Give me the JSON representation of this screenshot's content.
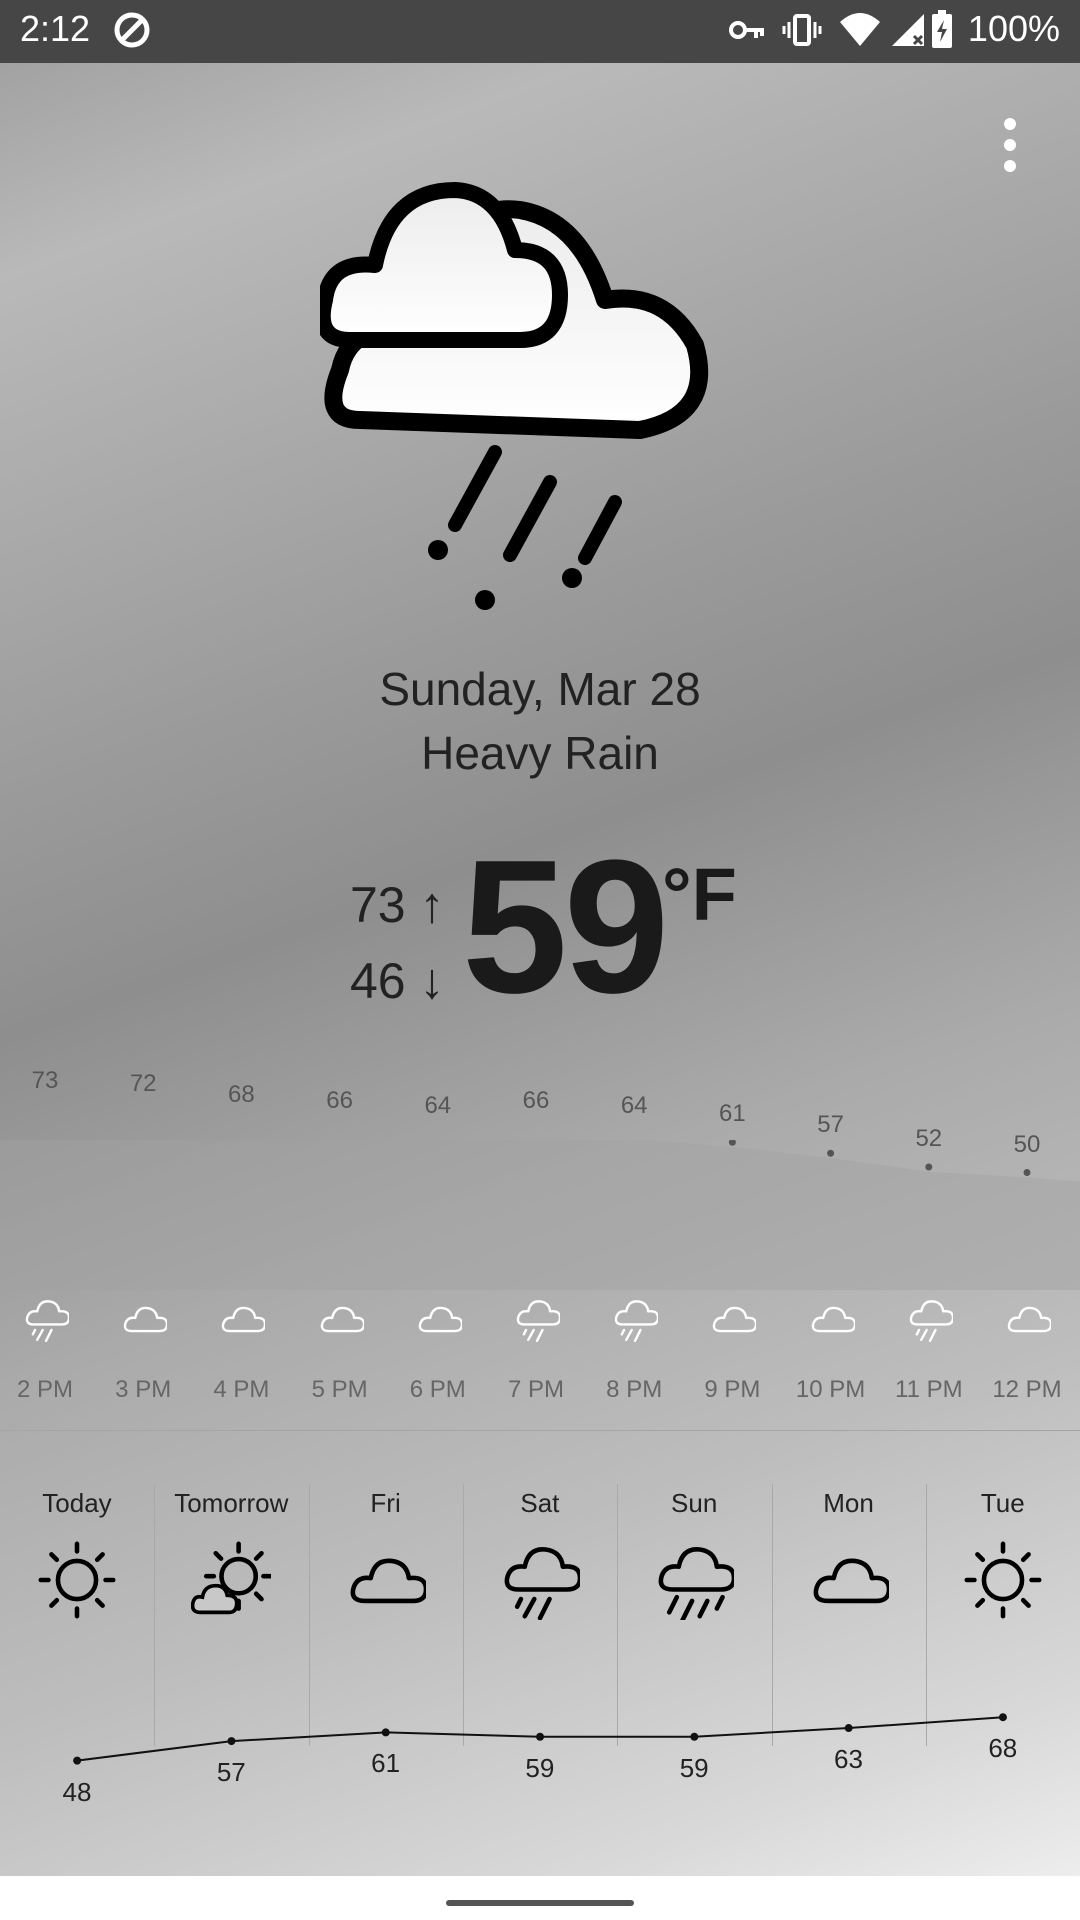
{
  "status_bar": {
    "time": "2:12",
    "battery_text": "100%",
    "icons": [
      "data-saver-icon",
      "vpn-key-icon",
      "vibrate-icon",
      "wifi-icon",
      "signal-icon",
      "battery-charging-icon"
    ]
  },
  "menu": {
    "icon": "more-vert-icon"
  },
  "current": {
    "icon": "heavy-rain-icon",
    "date": "Sunday, Mar 28",
    "condition": "Heavy Rain",
    "high": "73",
    "low": "46",
    "high_arrow": "↑",
    "low_arrow": "↓",
    "temp": "59",
    "unit": "°F"
  },
  "hourly": [
    {
      "time": "2 PM",
      "temp": 73,
      "icon": "rain-cloud-icon"
    },
    {
      "time": "3 PM",
      "temp": 72,
      "icon": "cloud-icon"
    },
    {
      "time": "4 PM",
      "temp": 68,
      "icon": "cloud-icon"
    },
    {
      "time": "5 PM",
      "temp": 66,
      "icon": "cloud-icon"
    },
    {
      "time": "6 PM",
      "temp": 64,
      "icon": "cloud-icon"
    },
    {
      "time": "7 PM",
      "temp": 66,
      "icon": "rain-cloud-icon"
    },
    {
      "time": "8 PM",
      "temp": 64,
      "icon": "rain-cloud-icon"
    },
    {
      "time": "9 PM",
      "temp": 61,
      "icon": "cloud-icon"
    },
    {
      "time": "10 PM",
      "temp": 57,
      "icon": "cloud-icon"
    },
    {
      "time": "11 PM",
      "temp": 52,
      "icon": "rain-cloud-icon"
    },
    {
      "time": "12 PM",
      "temp": 50,
      "icon": "cloud-icon"
    }
  ],
  "daily": [
    {
      "day": "Today",
      "temp": 48,
      "icon": "sun-icon"
    },
    {
      "day": "Tomorrow",
      "temp": 57,
      "icon": "partly-cloudy-icon"
    },
    {
      "day": "Fri",
      "temp": 61,
      "icon": "cloud-icon"
    },
    {
      "day": "Sat",
      "temp": 59,
      "icon": "rain-cloud-icon"
    },
    {
      "day": "Sun",
      "temp": 59,
      "icon": "heavy-rain-cloud-icon"
    },
    {
      "day": "Mon",
      "temp": 63,
      "icon": "cloud-icon"
    },
    {
      "day": "Tue",
      "temp": 68,
      "icon": "sun-icon"
    }
  ],
  "colors": {
    "status_bar": "#464646",
    "text_dark": "#222222",
    "text_muted": "#555555"
  }
}
